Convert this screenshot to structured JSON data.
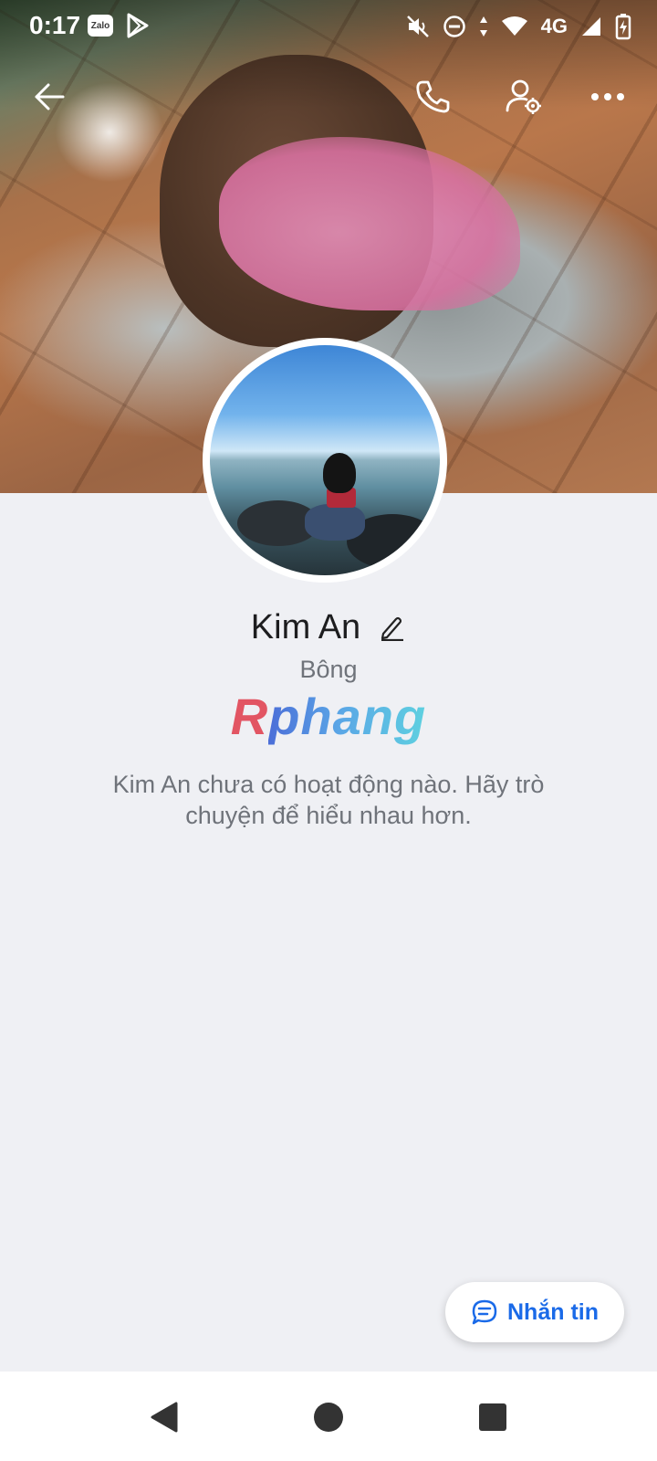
{
  "status_bar": {
    "time": "0:17",
    "zalo_badge": "Zalo",
    "network": "4G"
  },
  "profile": {
    "name": "Kim An",
    "alias": "Bông",
    "brand_logo_first": "R",
    "brand_logo_rest": "phang",
    "activity_text": "Kim An chưa có hoạt động nào. Hãy trò chuyện để hiểu nhau hơn."
  },
  "actions": {
    "message_label": "Nhắn tin"
  },
  "icons": {
    "back": "arrow-left-icon",
    "call": "phone-icon",
    "settings": "user-settings-icon",
    "more": "more-dots-icon",
    "edit": "pencil-icon",
    "message": "chat-bubble-icon"
  },
  "colors": {
    "accent": "#1a6ae8",
    "background": "#eff0f4",
    "text_primary": "#1d1d1f",
    "text_secondary": "#6f737a"
  }
}
